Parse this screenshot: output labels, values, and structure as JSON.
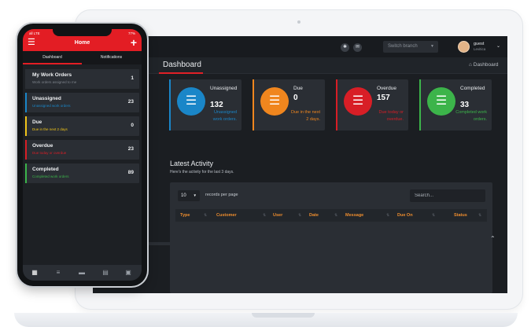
{
  "colors": {
    "accent": "#e31d24",
    "blue": "#1a86c8",
    "orange": "#f0861e",
    "red": "#d81e26",
    "green": "#3cb44a",
    "background": "#1b1e22",
    "card": "#2a2e34"
  },
  "desktop": {
    "topbar": {
      "settings_icon": "gear-icon",
      "message_icon": "envelope-icon",
      "switch_branch_placeholder": "Switch branch",
      "user_name": "guest",
      "user_sub": "Levitica"
    },
    "title": "Dashboard",
    "breadcrumb": "Dashboard",
    "stats": [
      {
        "label": "Unassigned",
        "count": "132",
        "sub": "Unassigned work orders.",
        "color": "#1a86c8"
      },
      {
        "label": "Due",
        "count": "0",
        "sub": "Due in the next 2 days.",
        "color": "#f0861e"
      },
      {
        "label": "Overdue",
        "count": "157",
        "sub": "Due today or overdue.",
        "color": "#d81e26"
      },
      {
        "label": "Completed",
        "count": "33",
        "sub": "Completed work orders.",
        "color": "#3cb44a"
      }
    ],
    "activity": {
      "title": "Latest Activity",
      "subtitle": "Here's the activity for the last 3 days.",
      "records_per_page": "10",
      "records_label": "records per page",
      "search_placeholder": "Search...",
      "columns": [
        "Type",
        "Customer",
        "User",
        "Date",
        "Message",
        "Due On",
        "Status"
      ]
    }
  },
  "phone": {
    "status_left": "all LTE",
    "status_right": "77%",
    "title": "Home",
    "tabs": [
      "Dashboard",
      "Notifications"
    ],
    "cards": [
      {
        "title": "My Work Orders",
        "sub": "Work orders assigned to me",
        "count": "1",
        "color": "#2a2e34",
        "sub_color": "#7d838b"
      },
      {
        "title": "Unassigned",
        "sub": "Unassigned work orders",
        "count": "23",
        "color": "#1a86c8",
        "sub_color": "#1a86c8"
      },
      {
        "title": "Due",
        "sub": "Due in the next 2 days",
        "count": "0",
        "color": "#f0c419",
        "sub_color": "#f0c419"
      },
      {
        "title": "Overdue",
        "sub": "Due today or overdue",
        "count": "23",
        "color": "#d81e26",
        "sub_color": "#d81e26"
      },
      {
        "title": "Completed",
        "sub": "Completed work orders",
        "count": "89",
        "color": "#3cb44a",
        "sub_color": "#3cb44a"
      }
    ],
    "nav_icons": [
      "dashboard-icon",
      "list-icon",
      "truck-icon",
      "document-icon",
      "briefcase-icon"
    ]
  }
}
